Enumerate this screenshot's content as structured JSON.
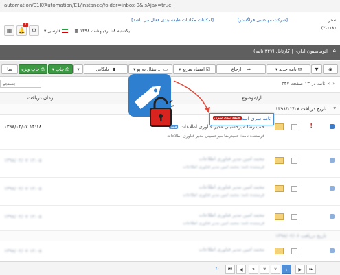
{
  "browser": {
    "url": "automation/E1K/Automation/E1/instance/folder=inbox-0&isAjax=true"
  },
  "header": {
    "company": "[شرکت مهندسی فراگستر]",
    "notice": "[امکانات مکاتبات طبقه بندی فعال می باشد]",
    "user": "ستر",
    "code": "(۲-۶۱۸)",
    "date": "یکشنبه ۰۸ اردیبهشت ۱۳۹۸",
    "language": "فارسی",
    "badge_count": "1"
  },
  "nav": {
    "breadcrumb": "اتوماسیون اداری  |  کارتابل (۳۴۷ نامه)"
  },
  "toolbar": {
    "new_letter": "نامه جدید",
    "forward": "ارجاع",
    "quick_sign": "امضاء سریع",
    "move_to": "انتقال به پو...",
    "archive": "بایگانی",
    "print": "چاپ",
    "special_print": "چاپ ویژه",
    "more": "سا"
  },
  "list": {
    "search_placeholder": "جستجو",
    "count_text": "۳۴۷ نامه در ۱۳ صفحه",
    "col_from": "از/موضوع",
    "col_date": "زمان دریافت",
    "groups": [
      "تاریخ دریافت  ۱۳۹۸/۰۲/۰۷",
      "تاریخ دریافت  ۱۳۹۸/۰۲/۰۶"
    ],
    "first_row": {
      "title": "حمیدرضا میرحسینی مدیر فناوری اطلاعات",
      "sub": "فرستنده نامه: حمیدرضا میرحسینی مدیر فناوری اطلاعات",
      "time": "۱۳۹۸/۰۲/۰۷ ۱۴:۱۸",
      "tag": "مهم",
      "flag": "!"
    },
    "blur_title": "محمد امین مدیر فناوری اطلاعات",
    "blur_sub": "فرستنده نامه: محمد امین مدیر فناوری اطلاعات",
    "blur_time": "۱۳۹۸/۰۲/۰۷ ۱۲:۰۵"
  },
  "tooltip": {
    "text": "نامه سری است",
    "badge": "طبقه بندی سری"
  },
  "pager": {
    "pages": [
      "۴",
      "۳",
      "۲",
      "۱"
    ],
    "active": "۱"
  },
  "colors": {
    "accent": "#4a8fd6",
    "danger": "#d9231f",
    "toolbar_green": "#3c9a43",
    "lock": "#d9231f"
  }
}
